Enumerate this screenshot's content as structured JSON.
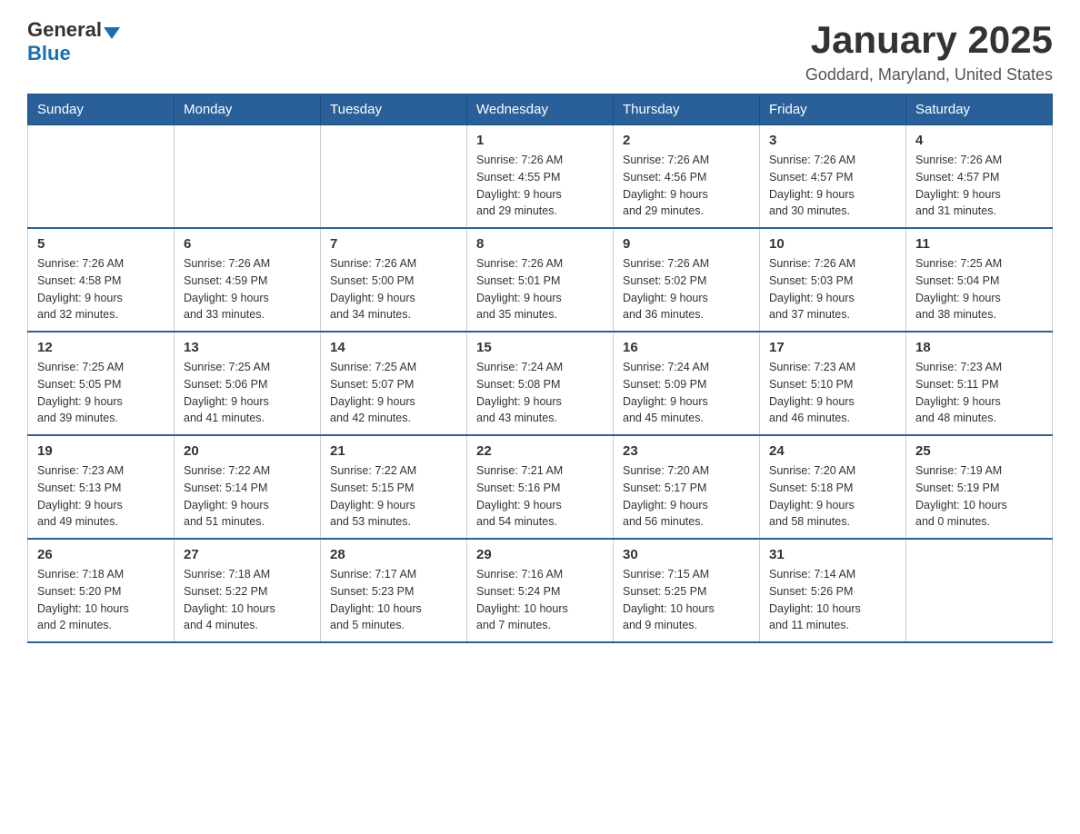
{
  "logo": {
    "general": "General",
    "blue": "Blue"
  },
  "title": "January 2025",
  "location": "Goddard, Maryland, United States",
  "weekdays": [
    "Sunday",
    "Monday",
    "Tuesday",
    "Wednesday",
    "Thursday",
    "Friday",
    "Saturday"
  ],
  "weeks": [
    [
      {
        "day": "",
        "info": ""
      },
      {
        "day": "",
        "info": ""
      },
      {
        "day": "",
        "info": ""
      },
      {
        "day": "1",
        "info": "Sunrise: 7:26 AM\nSunset: 4:55 PM\nDaylight: 9 hours\nand 29 minutes."
      },
      {
        "day": "2",
        "info": "Sunrise: 7:26 AM\nSunset: 4:56 PM\nDaylight: 9 hours\nand 29 minutes."
      },
      {
        "day": "3",
        "info": "Sunrise: 7:26 AM\nSunset: 4:57 PM\nDaylight: 9 hours\nand 30 minutes."
      },
      {
        "day": "4",
        "info": "Sunrise: 7:26 AM\nSunset: 4:57 PM\nDaylight: 9 hours\nand 31 minutes."
      }
    ],
    [
      {
        "day": "5",
        "info": "Sunrise: 7:26 AM\nSunset: 4:58 PM\nDaylight: 9 hours\nand 32 minutes."
      },
      {
        "day": "6",
        "info": "Sunrise: 7:26 AM\nSunset: 4:59 PM\nDaylight: 9 hours\nand 33 minutes."
      },
      {
        "day": "7",
        "info": "Sunrise: 7:26 AM\nSunset: 5:00 PM\nDaylight: 9 hours\nand 34 minutes."
      },
      {
        "day": "8",
        "info": "Sunrise: 7:26 AM\nSunset: 5:01 PM\nDaylight: 9 hours\nand 35 minutes."
      },
      {
        "day": "9",
        "info": "Sunrise: 7:26 AM\nSunset: 5:02 PM\nDaylight: 9 hours\nand 36 minutes."
      },
      {
        "day": "10",
        "info": "Sunrise: 7:26 AM\nSunset: 5:03 PM\nDaylight: 9 hours\nand 37 minutes."
      },
      {
        "day": "11",
        "info": "Sunrise: 7:25 AM\nSunset: 5:04 PM\nDaylight: 9 hours\nand 38 minutes."
      }
    ],
    [
      {
        "day": "12",
        "info": "Sunrise: 7:25 AM\nSunset: 5:05 PM\nDaylight: 9 hours\nand 39 minutes."
      },
      {
        "day": "13",
        "info": "Sunrise: 7:25 AM\nSunset: 5:06 PM\nDaylight: 9 hours\nand 41 minutes."
      },
      {
        "day": "14",
        "info": "Sunrise: 7:25 AM\nSunset: 5:07 PM\nDaylight: 9 hours\nand 42 minutes."
      },
      {
        "day": "15",
        "info": "Sunrise: 7:24 AM\nSunset: 5:08 PM\nDaylight: 9 hours\nand 43 minutes."
      },
      {
        "day": "16",
        "info": "Sunrise: 7:24 AM\nSunset: 5:09 PM\nDaylight: 9 hours\nand 45 minutes."
      },
      {
        "day": "17",
        "info": "Sunrise: 7:23 AM\nSunset: 5:10 PM\nDaylight: 9 hours\nand 46 minutes."
      },
      {
        "day": "18",
        "info": "Sunrise: 7:23 AM\nSunset: 5:11 PM\nDaylight: 9 hours\nand 48 minutes."
      }
    ],
    [
      {
        "day": "19",
        "info": "Sunrise: 7:23 AM\nSunset: 5:13 PM\nDaylight: 9 hours\nand 49 minutes."
      },
      {
        "day": "20",
        "info": "Sunrise: 7:22 AM\nSunset: 5:14 PM\nDaylight: 9 hours\nand 51 minutes."
      },
      {
        "day": "21",
        "info": "Sunrise: 7:22 AM\nSunset: 5:15 PM\nDaylight: 9 hours\nand 53 minutes."
      },
      {
        "day": "22",
        "info": "Sunrise: 7:21 AM\nSunset: 5:16 PM\nDaylight: 9 hours\nand 54 minutes."
      },
      {
        "day": "23",
        "info": "Sunrise: 7:20 AM\nSunset: 5:17 PM\nDaylight: 9 hours\nand 56 minutes."
      },
      {
        "day": "24",
        "info": "Sunrise: 7:20 AM\nSunset: 5:18 PM\nDaylight: 9 hours\nand 58 minutes."
      },
      {
        "day": "25",
        "info": "Sunrise: 7:19 AM\nSunset: 5:19 PM\nDaylight: 10 hours\nand 0 minutes."
      }
    ],
    [
      {
        "day": "26",
        "info": "Sunrise: 7:18 AM\nSunset: 5:20 PM\nDaylight: 10 hours\nand 2 minutes."
      },
      {
        "day": "27",
        "info": "Sunrise: 7:18 AM\nSunset: 5:22 PM\nDaylight: 10 hours\nand 4 minutes."
      },
      {
        "day": "28",
        "info": "Sunrise: 7:17 AM\nSunset: 5:23 PM\nDaylight: 10 hours\nand 5 minutes."
      },
      {
        "day": "29",
        "info": "Sunrise: 7:16 AM\nSunset: 5:24 PM\nDaylight: 10 hours\nand 7 minutes."
      },
      {
        "day": "30",
        "info": "Sunrise: 7:15 AM\nSunset: 5:25 PM\nDaylight: 10 hours\nand 9 minutes."
      },
      {
        "day": "31",
        "info": "Sunrise: 7:14 AM\nSunset: 5:26 PM\nDaylight: 10 hours\nand 11 minutes."
      },
      {
        "day": "",
        "info": ""
      }
    ]
  ]
}
